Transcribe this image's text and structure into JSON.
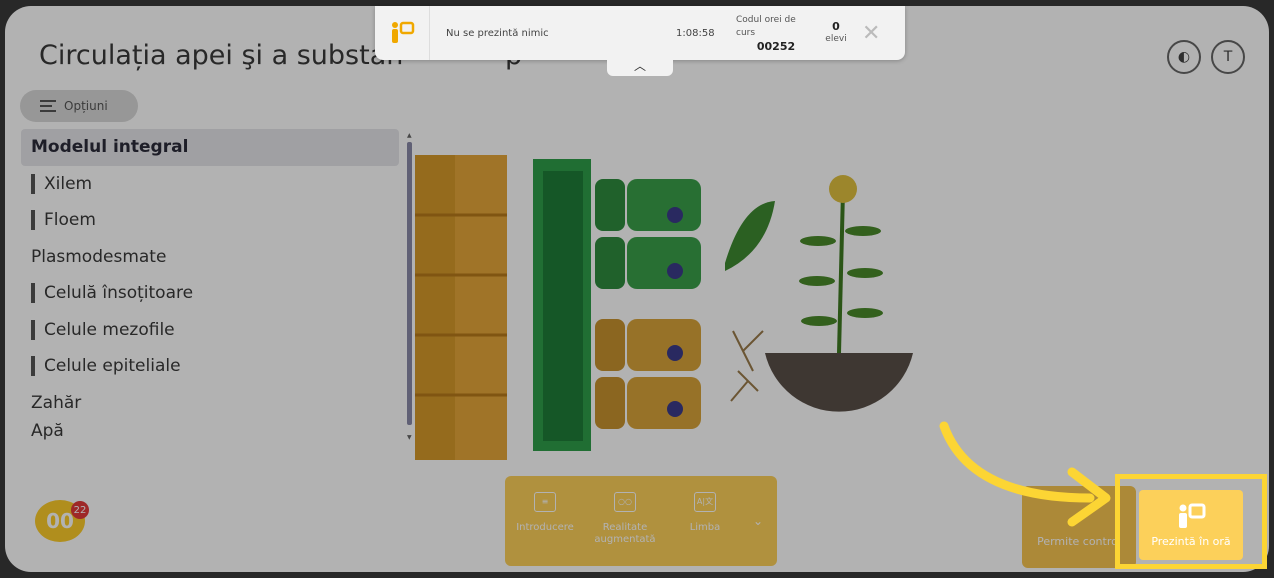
{
  "lesson": {
    "title_start": "Circulația apei şi a substan",
    "title_end": "p"
  },
  "options": {
    "label": "Opțiuni"
  },
  "menu": {
    "items": [
      {
        "label": "Modelul integral"
      },
      {
        "label": "Xilem"
      },
      {
        "label": "Floem"
      },
      {
        "label": "Plasmodesmate"
      },
      {
        "label": "Celulă însoțitoare"
      },
      {
        "label": "Celule mezofile"
      },
      {
        "label": "Celule epiteliale"
      },
      {
        "label": "Zahăr"
      },
      {
        "label": "Apă"
      }
    ]
  },
  "tabs": [
    {
      "label": "Introducere",
      "icon": "book-icon"
    },
    {
      "label": "Realitate augmentată",
      "icon": "ar-glasses-icon"
    },
    {
      "label": "Limba",
      "icon": "language-icon"
    }
  ],
  "avatar": {
    "text": "00",
    "badge": "22"
  },
  "permite_control": {
    "label": "Permite control"
  },
  "present_button": {
    "label": "Prezintă în oră"
  },
  "toolbar": {
    "status": "Nu se prezintă nimic",
    "time": "1:08:58",
    "code_label": "Codul orei de curs",
    "code_value": "00252",
    "students_count": "0",
    "students_label": "elevi"
  },
  "colors": {
    "accent": "#fcd05a",
    "highlight": "#fcd534"
  }
}
